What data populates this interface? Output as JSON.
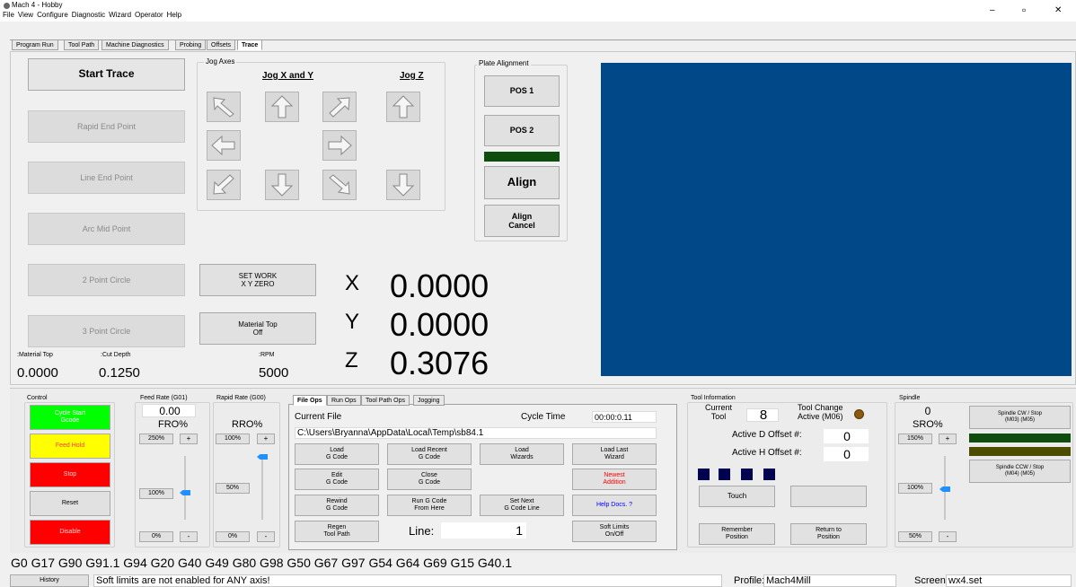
{
  "window": {
    "title": "Mach 4 - Hobby",
    "minimize": "–",
    "restore": "▫",
    "close": "✕"
  },
  "menu": [
    "File",
    "View",
    "Configure",
    "Diagnostic",
    "Wizard",
    "Operator",
    "Help"
  ],
  "tabs": [
    "Program Run",
    "Tool Path",
    "Machine Diagnostics",
    "Probing",
    "Offsets",
    "Trace"
  ],
  "trace": {
    "start": "Start Trace",
    "buttons": [
      "Rapid End Point",
      "Line End Point",
      "Arc Mid Point",
      "2 Point Circle",
      "3 Point Circle"
    ],
    "jog_group": "Jog Axes",
    "jog_xy": "Jog X and Y",
    "jog_z": "Jog Z",
    "plate_group": "Plate Alignment",
    "pos1": "POS 1",
    "pos2": "POS 2",
    "align": "Align",
    "align_cancel": "Align\nCancel",
    "set_work": "SET WORK\nX Y ZERO",
    "material_top_btn": "Material Top\nOff",
    "material_top_label": ":Material Top",
    "cut_depth_label": ":Cut Depth",
    "rpm_label": ":RPM",
    "material_top_value": "0.0000",
    "cut_depth_value": "0.1250",
    "rpm_value": "5000",
    "axes": [
      {
        "name": "X",
        "value": "0.0000"
      },
      {
        "name": "Y",
        "value": "0.0000"
      },
      {
        "name": "Z",
        "value": "0.3076"
      }
    ]
  },
  "control": {
    "label": "Control",
    "cycle_start": "Cycle Start\nGcode",
    "feed_hold": "Feed Hold",
    "stop": "Stop",
    "reset": "Reset",
    "disable": "Disable"
  },
  "feed": {
    "label": "Feed Rate (G01)",
    "value": "0.00",
    "name": "FRO%",
    "preset": "250%",
    "plus": "+",
    "current": "100%",
    "zero": "0%",
    "minus": "-",
    "level": 1.0
  },
  "rapid": {
    "label": "Rapid Rate (G00)",
    "name": "RRO%",
    "preset": "100%",
    "plus": "+",
    "current": "50%",
    "zero": "0%",
    "minus": "-",
    "level": 1.0
  },
  "fileops": {
    "tabs": [
      "File Ops",
      "Run Ops",
      "Tool Path Ops",
      "Jogging"
    ],
    "current_file_label": "Current File",
    "cycle_time_label": "Cycle Time",
    "cycle_time": "00:00:0.11",
    "path": "C:\\Users\\Bryanna\\AppData\\Local\\Temp\\sb84.1",
    "buttons": [
      [
        "Load\nG Code",
        "Load Recent\nG Code",
        "Load\nWizards",
        "Load Last\nWizard"
      ],
      [
        "Edit\nG Code",
        "Close\nG Code",
        "",
        "Newest\nAddition"
      ],
      [
        "Rewind\nG Code",
        "Run G Code\nFrom Here",
        "Set Next\nG Code Line",
        "Help Docs. ?"
      ],
      [
        "Regen\nTool Path",
        "",
        "",
        "Soft Limits\nOn/Off"
      ]
    ],
    "line_label": "Line:",
    "line_value": "1"
  },
  "tool": {
    "label": "Tool Information",
    "current_label": "Current\nTool",
    "current_value": "8",
    "change_label": "Tool Change\nActive (M06)",
    "d_label": "Active D Offset #:",
    "d_value": "0",
    "h_label": "Active H Offset #:",
    "h_value": "0",
    "touch": "Touch",
    "remember": "Remember\nPosition",
    "return": "Return to\nPosition"
  },
  "spindle": {
    "label": "Spindle",
    "value": "0",
    "name": "SRO%",
    "preset": "150%",
    "plus": "+",
    "current": "100%",
    "min": "50%",
    "minus": "-",
    "cw": "Spindle CW / Stop\n(M03)          (M05)",
    "ccw": "Spindle CCW / Stop\n(M04)          (M05)"
  },
  "gcode_line": "G0 G17 G90 G91.1 G94 G20 G40 G49 G80 G98 G50 G67 G97 G54 G64 G69 G15 G40.1",
  "status": {
    "history": "History",
    "message": "Soft limits are not enabled for ANY axis!",
    "profile_label": "Profile:",
    "profile": "Mach4Mill",
    "screen_label": "Screen",
    "screen": "wx4.set"
  },
  "colors": {
    "toolpath_bg": "#014889",
    "green": "#00ff00",
    "yellow": "#ffff00",
    "red": "#ff0000",
    "dark_green": "#0e4d0e",
    "olive": "#4d4d00"
  }
}
